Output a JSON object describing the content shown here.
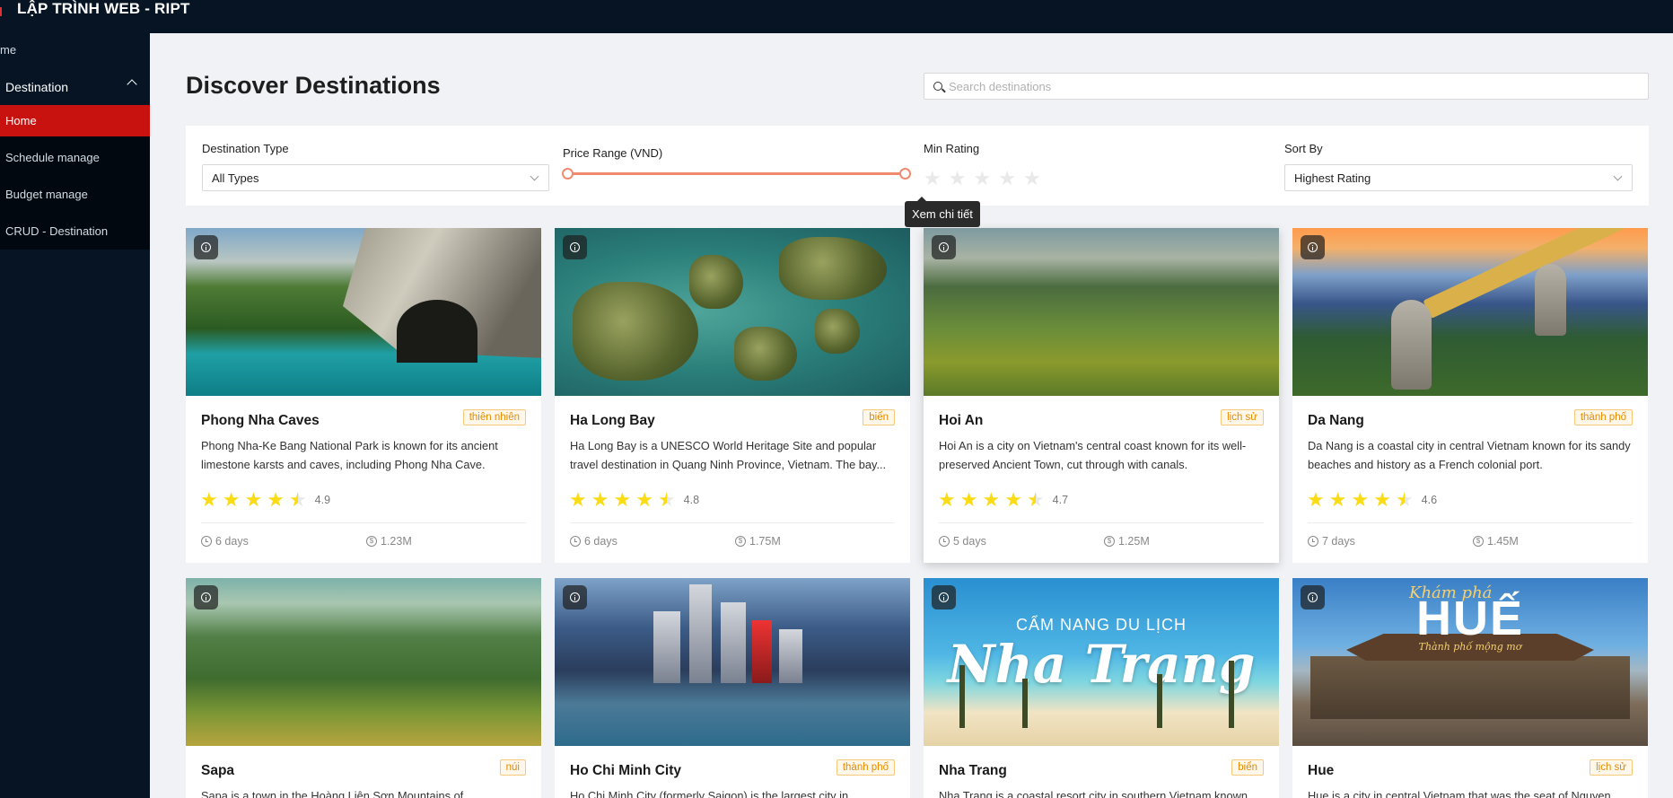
{
  "header": {
    "brand": "LẬP TRÌNH WEB - RIPT"
  },
  "sidebar": {
    "root_item": "me",
    "group_label": "Destination",
    "items": [
      {
        "label": "Home",
        "active": true
      },
      {
        "label": "Schedule manage"
      },
      {
        "label": "Budget manage"
      },
      {
        "label": "CRUD - Destination"
      }
    ]
  },
  "page": {
    "title": "Discover Destinations"
  },
  "search": {
    "placeholder": "Search destinations"
  },
  "filters": {
    "type_label": "Destination Type",
    "type_value": "All Types",
    "price_label": "Price Range (VND)",
    "rating_label": "Min Rating",
    "rating_value": 0,
    "sort_label": "Sort By",
    "sort_value": "Highest Rating"
  },
  "tooltip": {
    "text": "Xem chi tiết"
  },
  "colors": {
    "sidebar_bg": "#061424",
    "active": "#c8120f",
    "star": "#fadb14",
    "badge": "#e58a00"
  },
  "destinations": [
    {
      "name": "Phong Nha Caves",
      "tag": "thiên nhiên",
      "desc": "Phong Nha-Ke Bang National Park is known for its ancient limestone karsts and caves, including Phong Nha Cave.",
      "rating": "4.9",
      "days": "6 days",
      "price": "1.23M"
    },
    {
      "name": "Ha Long Bay",
      "tag": "biển",
      "desc": "Ha Long Bay is a UNESCO World Heritage Site and popular travel destination in Quang Ninh Province, Vietnam. The bay...",
      "rating": "4.8",
      "days": "6 days",
      "price": "1.75M"
    },
    {
      "name": "Hoi An",
      "tag": "lịch sử",
      "desc": "Hoi An is a city on Vietnam's central coast known for its well-preserved Ancient Town, cut through with canals.",
      "rating": "4.7",
      "days": "5 days",
      "price": "1.25M"
    },
    {
      "name": "Da Nang",
      "tag": "thành phố",
      "desc": "Da Nang is a coastal city in central Vietnam known for its sandy beaches and history as a French colonial port.",
      "rating": "4.6",
      "days": "7 days",
      "price": "1.45M"
    },
    {
      "name": "Sapa",
      "tag": "núi",
      "desc": "Sapa is a town in the Hoàng Liên Sơn Mountains of"
    },
    {
      "name": "Ho Chi Minh City",
      "tag": "thành phố",
      "desc": "Ho Chi Minh City (formerly Saigon) is the largest city in"
    },
    {
      "name": "Nha Trang",
      "tag": "biển",
      "desc": "Nha Trang is a coastal resort city in southern Vietnam known",
      "img_text_1": "CẨM NANG DU LỊCH",
      "img_text_2": "Nha Trang"
    },
    {
      "name": "Hue",
      "tag": "lịch sử",
      "desc": "Hue is a city in central Vietnam that was the seat of Nguyen",
      "img_text_1": "Khám phá",
      "img_text_2": "HUẾ",
      "img_text_3": "Thành phố mộng mơ"
    }
  ]
}
